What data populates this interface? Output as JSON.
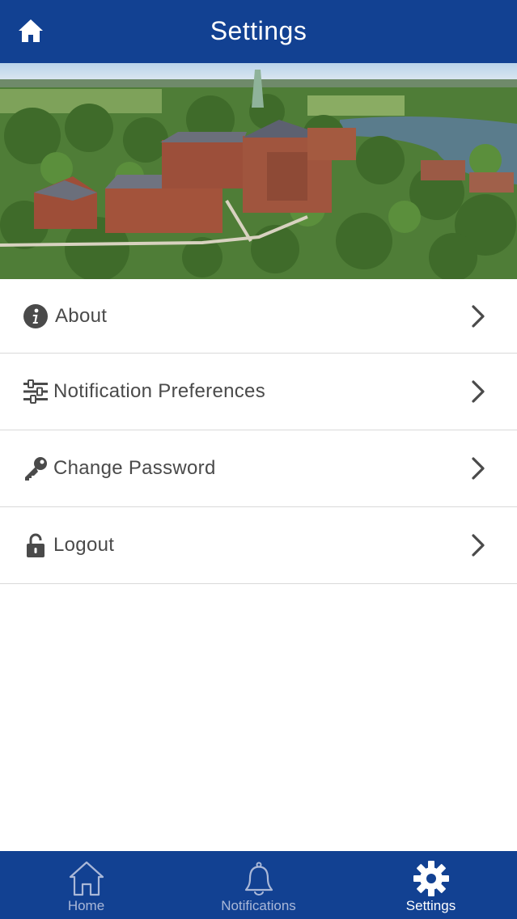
{
  "header": {
    "title": "Settings",
    "home_icon": "home-icon"
  },
  "menu": {
    "items": [
      {
        "label": "About",
        "icon": "info-icon"
      },
      {
        "label": "Notification Preferences",
        "icon": "sliders-icon"
      },
      {
        "label": "Change Password",
        "icon": "key-icon"
      },
      {
        "label": "Logout",
        "icon": "unlock-icon"
      }
    ]
  },
  "tabs": [
    {
      "label": "Home",
      "icon": "home-outline-icon",
      "active": false
    },
    {
      "label": "Notifications",
      "icon": "bell-icon",
      "active": false
    },
    {
      "label": "Settings",
      "icon": "gear-icon",
      "active": true
    }
  ],
  "colors": {
    "primary": "#124192",
    "text": "#4a4a4a",
    "divider": "#d9d9d9",
    "tab_inactive": "#aab8d8"
  }
}
